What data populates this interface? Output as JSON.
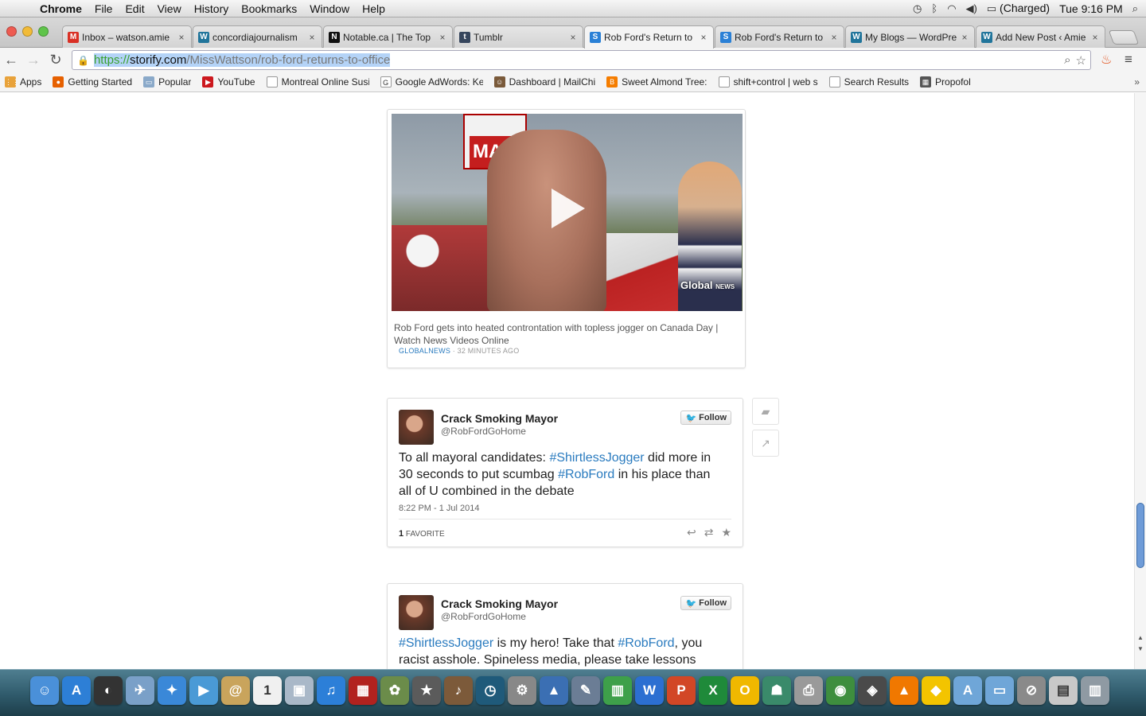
{
  "menubar": {
    "app_name": "Chrome",
    "items": [
      "File",
      "Edit",
      "View",
      "History",
      "Bookmarks",
      "Window",
      "Help"
    ],
    "battery_status": "(Charged)",
    "clock": "Tue 9:16 PM"
  },
  "tabs": [
    {
      "title": "Inbox – watson.amie",
      "favicon": "gmail-icon",
      "active": false
    },
    {
      "title": "concordiajournalism",
      "favicon": "wordpress-icon",
      "active": false
    },
    {
      "title": "Notable.ca | The Top",
      "favicon": "notable-icon",
      "active": false
    },
    {
      "title": "Tumblr",
      "favicon": "tumblr-icon",
      "active": false
    },
    {
      "title": "Rob Ford's Return to",
      "favicon": "storify-icon",
      "active": true
    },
    {
      "title": "Rob Ford's Return to",
      "favicon": "storify-icon",
      "active": false
    },
    {
      "title": "My Blogs — WordPre",
      "favicon": "wordpress-icon",
      "active": false
    },
    {
      "title": "Add New Post ‹ Amie",
      "favicon": "wordpress-icon",
      "active": false
    }
  ],
  "address_bar": {
    "scheme": "https://",
    "domain": "storify.com",
    "path": "/MissWattson/rob-ford-returns-to-office"
  },
  "bookmarks": [
    {
      "label": "Apps",
      "icon": "apps-grid-icon"
    },
    {
      "label": "Getting Started",
      "icon": "firefox-icon"
    },
    {
      "label": "Popular",
      "icon": "folder-icon"
    },
    {
      "label": "YouTube",
      "icon": "youtube-icon"
    },
    {
      "label": "Montreal Online Susi",
      "icon": "page-icon"
    },
    {
      "label": "Google AdWords: Ke",
      "icon": "google-icon"
    },
    {
      "label": "Dashboard | MailChi",
      "icon": "mailchimp-icon"
    },
    {
      "label": "Sweet Almond Tree:",
      "icon": "blogger-icon"
    },
    {
      "label": "shift+control | web s",
      "icon": "page-icon"
    },
    {
      "label": "Search Results",
      "icon": "page-icon"
    },
    {
      "label": "Propofol",
      "icon": "image-icon"
    }
  ],
  "video_card": {
    "caption": "Rob Ford gets into heated controntation with topless jogger on Canada Day | Watch News Videos Online",
    "source": "GLOBALNEWS",
    "time_ago": "32 MINUTES AGO",
    "sign_text": "MA",
    "watermark": "Global",
    "watermark_sub": "NEWS"
  },
  "tweets": [
    {
      "author": "Crack Smoking Mayor",
      "handle": "@RobFordGoHome",
      "follow_label": "Follow",
      "text_parts": [
        {
          "t": "To all mayoral candidates: ",
          "tag": false
        },
        {
          "t": "#ShirtlessJogger",
          "tag": true
        },
        {
          "t": " did more in 30 seconds to put scumbag ",
          "tag": false
        },
        {
          "t": "#RobFord",
          "tag": true
        },
        {
          "t": " in his place than all of U combined in the debate",
          "tag": false
        }
      ],
      "timestamp": "8:22 PM - 1 Jul 2014",
      "favorites_count": "1",
      "favorites_label": "FAVORITE"
    },
    {
      "author": "Crack Smoking Mayor",
      "handle": "@RobFordGoHome",
      "follow_label": "Follow",
      "text_parts": [
        {
          "t": "#ShirtlessJogger",
          "tag": true
        },
        {
          "t": " is my hero! Take that ",
          "tag": false
        },
        {
          "t": "#RobFord",
          "tag": true
        },
        {
          "t": ", you racist asshole. Spineless media, please take lessons",
          "tag": false
        }
      ]
    }
  ],
  "dock_apps": [
    {
      "name": "finder-icon",
      "color": "#4a90d9",
      "glyph": "☺"
    },
    {
      "name": "app-store-icon",
      "color": "#2d7fd6",
      "glyph": "A"
    },
    {
      "name": "dashboard-icon",
      "color": "#333333",
      "glyph": "◐"
    },
    {
      "name": "mail-bird-icon",
      "color": "#7aa0c8",
      "glyph": "✈"
    },
    {
      "name": "safari-icon",
      "color": "#3a88d8",
      "glyph": "✦"
    },
    {
      "name": "facetime-icon",
      "color": "#4a9ad6",
      "glyph": "▶"
    },
    {
      "name": "contacts-icon",
      "color": "#c9a45c",
      "glyph": "@"
    },
    {
      "name": "calendar-icon",
      "color": "#f0f0f0",
      "glyph": "1"
    },
    {
      "name": "preview-icon",
      "color": "#a9b8c8",
      "glyph": "▣"
    },
    {
      "name": "itunes-icon",
      "color": "#2c7fd8",
      "glyph": "♫"
    },
    {
      "name": "photo-booth-icon",
      "color": "#b2221f",
      "glyph": "▦"
    },
    {
      "name": "iphoto-icon",
      "color": "#6b8c4a",
      "glyph": "✿"
    },
    {
      "name": "imovie-icon",
      "color": "#5b5b5b",
      "glyph": "★"
    },
    {
      "name": "garageband-icon",
      "color": "#7c5a3a",
      "glyph": "♪"
    },
    {
      "name": "time-machine-icon",
      "color": "#1f5a7a",
      "glyph": "◷"
    },
    {
      "name": "system-preferences-icon",
      "color": "#888888",
      "glyph": "⚙"
    },
    {
      "name": "keynote-icon",
      "color": "#3b6fb3",
      "glyph": "▲"
    },
    {
      "name": "pages-icon",
      "color": "#6b7d95",
      "glyph": "✎"
    },
    {
      "name": "numbers-icon",
      "color": "#3ea04a",
      "glyph": "▥"
    },
    {
      "name": "word-icon",
      "color": "#2c6fd1",
      "glyph": "W"
    },
    {
      "name": "powerpoint-icon",
      "color": "#d24726",
      "glyph": "P"
    },
    {
      "name": "excel-icon",
      "color": "#1f8a3a",
      "glyph": "X"
    },
    {
      "name": "outlook-icon",
      "color": "#f0b800",
      "glyph": "O"
    },
    {
      "name": "network-icon",
      "color": "#3a8a6a",
      "glyph": "☗"
    },
    {
      "name": "printer-icon",
      "color": "#9a9a9a",
      "glyph": "⎙"
    },
    {
      "name": "chrome-icon",
      "color": "#3e8e3e",
      "glyph": "◉"
    },
    {
      "name": "photoshop-icon",
      "color": "#4a4a4a",
      "glyph": "◈"
    },
    {
      "name": "vlc-icon",
      "color": "#f07800",
      "glyph": "▲"
    },
    {
      "name": "cyberduck-icon",
      "color": "#f3c400",
      "glyph": "◆"
    },
    {
      "name": "applications-folder-icon",
      "color": "#6fa6d8",
      "glyph": "A"
    },
    {
      "name": "documents-folder-icon",
      "color": "#6fa6d8",
      "glyph": "▭"
    },
    {
      "name": "disabled-icon",
      "color": "#8a8a8a",
      "glyph": "⊘"
    },
    {
      "name": "downloads-icon",
      "color": "#c8c8c8",
      "glyph": "▤"
    },
    {
      "name": "trash-icon",
      "color": "#8f9aa3",
      "glyph": "▥"
    }
  ]
}
